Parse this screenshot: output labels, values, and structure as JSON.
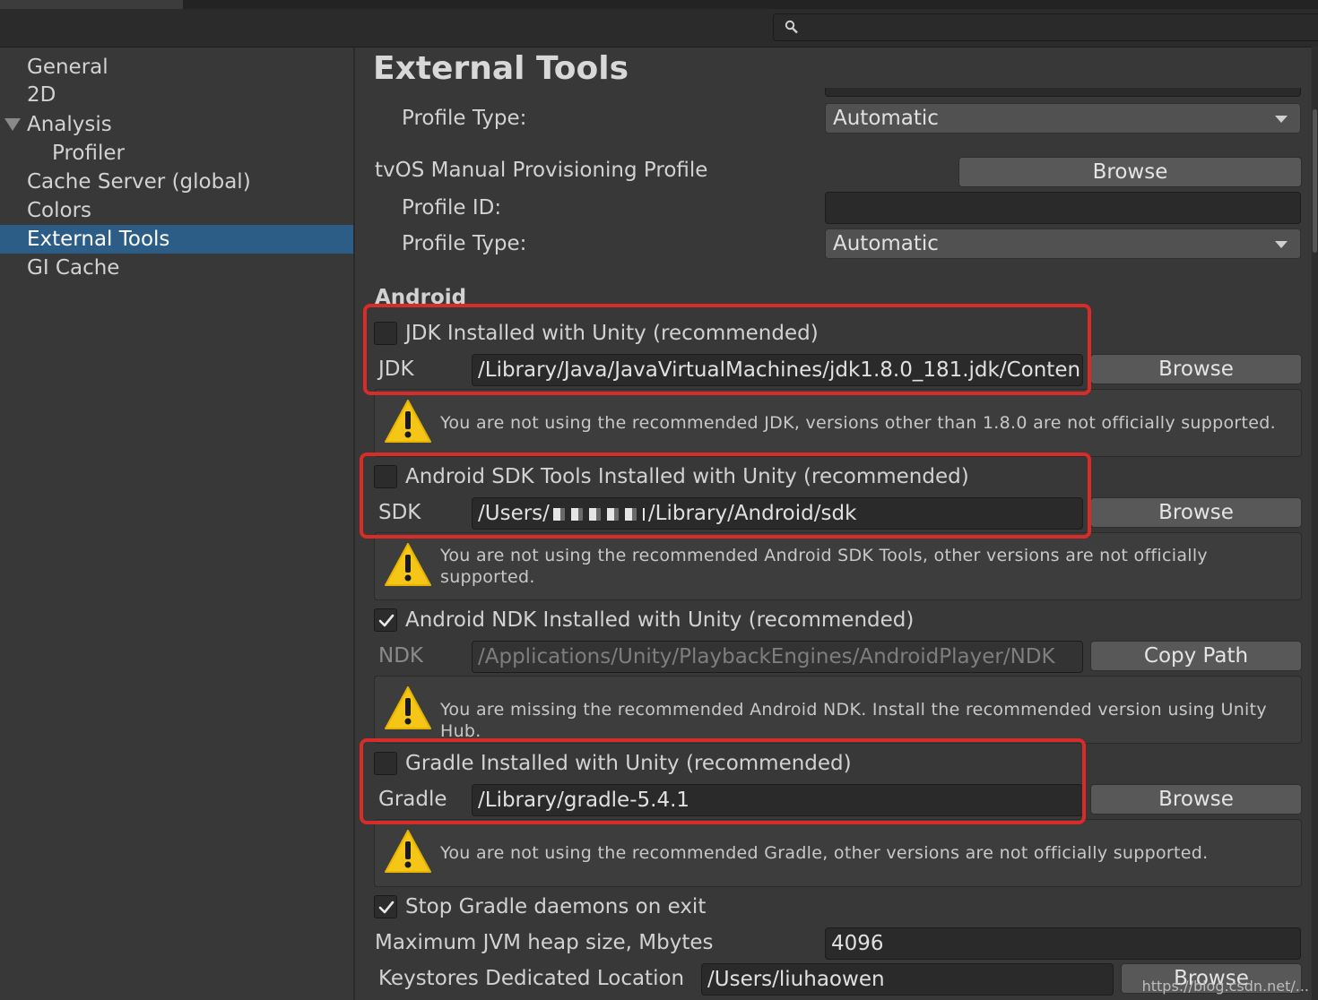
{
  "search": {
    "placeholder": ""
  },
  "sidebar": {
    "items": [
      {
        "label": "General"
      },
      {
        "label": "2D"
      },
      {
        "label": "Analysis"
      },
      {
        "label": "Profiler"
      },
      {
        "label": "Cache Server (global)"
      },
      {
        "label": "Colors"
      },
      {
        "label": "External Tools",
        "selected": true
      },
      {
        "label": "GI Cache"
      }
    ]
  },
  "main": {
    "title": "External Tools",
    "ios_profile_type": {
      "label": "Profile Type:",
      "value": "Automatic"
    },
    "tvos": {
      "section_label": "tvOS Manual Provisioning Profile",
      "browse_label": "Browse",
      "profile_id_label": "Profile ID:",
      "profile_id_value": "",
      "profile_type_label": "Profile Type:",
      "profile_type_value": "Automatic"
    },
    "android": {
      "section_label": "Android",
      "jdk": {
        "checkbox_label": "JDK Installed with Unity (recommended)",
        "checked": false,
        "field_label": "JDK",
        "path": "/Library/Java/JavaVirtualMachines/jdk1.8.0_181.jdk/Conten",
        "button_label": "Browse",
        "warning": "You are not using the recommended JDK, versions other than 1.8.0 are not officially supported."
      },
      "sdk": {
        "checkbox_label": "Android SDK Tools Installed with Unity (recommended)",
        "checked": false,
        "field_label": "SDK",
        "path_prefix": "/Users/",
        "path_suffix": "/Library/Android/sdk",
        "button_label": "Browse",
        "warning": "You are not using the recommended Android SDK Tools, other versions are not officially supported."
      },
      "ndk": {
        "checkbox_label": "Android NDK Installed with Unity (recommended)",
        "checked": true,
        "field_label": "NDK",
        "path": "/Applications/Unity/PlaybackEngines/AndroidPlayer/NDK",
        "button_label": "Copy Path",
        "warning": "You are missing the recommended Android NDK. Install the recommended version using Unity Hub."
      },
      "gradle": {
        "checkbox_label": "Gradle Installed with Unity (recommended)",
        "checked": false,
        "field_label": "Gradle",
        "path": "/Library/gradle-5.4.1",
        "button_label": "Browse",
        "warning": "You are not using the recommended Gradle, other versions are not officially supported."
      },
      "stop_gradle": {
        "label": "Stop Gradle daemons on exit",
        "checked": true
      },
      "jvm_heap": {
        "label": "Maximum JVM heap size, Mbytes",
        "value": "4096"
      },
      "keystores": {
        "label": "Keystores Dedicated Location",
        "value": "/Users/liuhaowen",
        "button_label": "Browse"
      }
    }
  },
  "watermark": "https://blog.csdn.net/...",
  "colors": {
    "selection": "#2c5d87",
    "highlight_border": "#d92b27",
    "warning": "#f5c518"
  },
  "icons": [
    "search-icon",
    "warning-icon",
    "checkmark-icon",
    "dropdown-arrow-icon"
  ]
}
